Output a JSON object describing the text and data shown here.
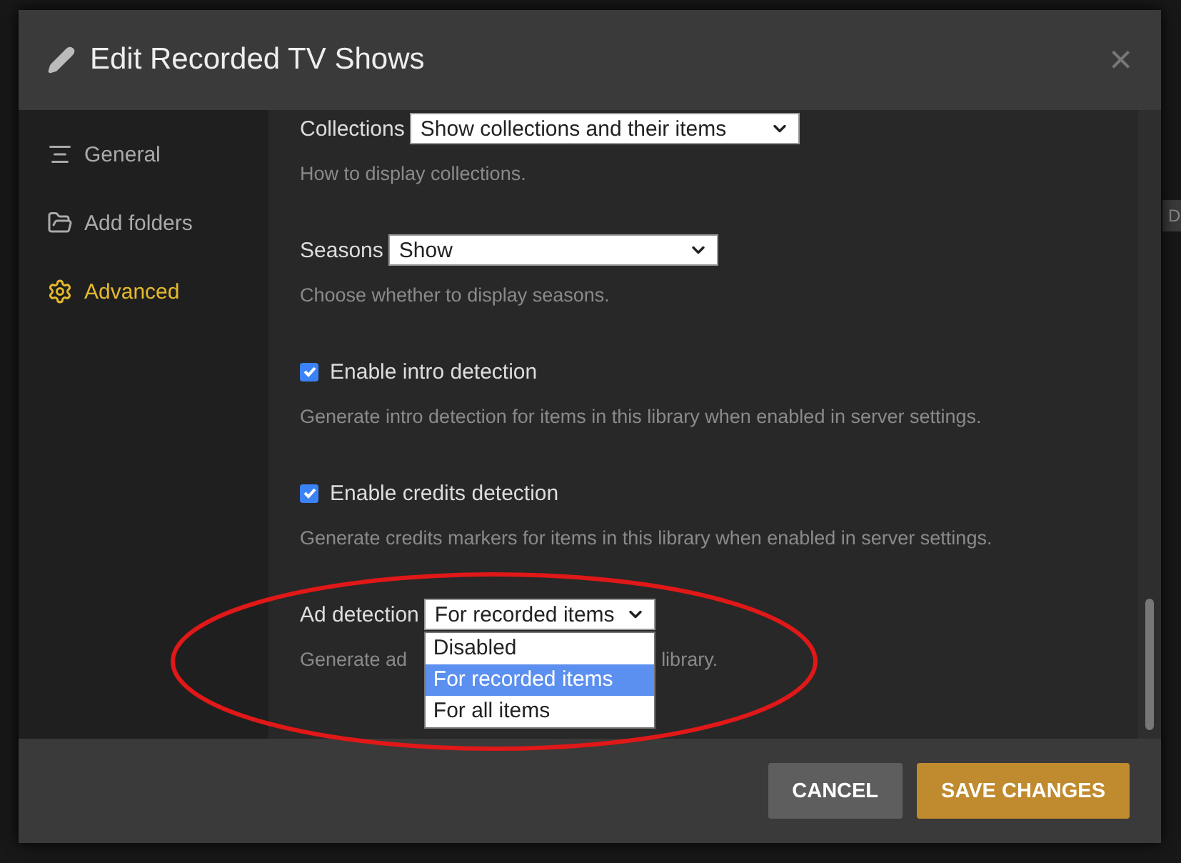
{
  "background_fragment": "D",
  "dialog": {
    "title": "Edit Recorded TV Shows",
    "close": "×"
  },
  "sidebar": {
    "items": [
      {
        "label": "General",
        "selected": false
      },
      {
        "label": "Add folders",
        "selected": false
      },
      {
        "label": "Advanced",
        "selected": true
      }
    ]
  },
  "settings": [
    {
      "kind": "select",
      "label": "Collections",
      "value": "Show collections and their items",
      "hint": "How to display collections."
    },
    {
      "kind": "select",
      "label": "Seasons",
      "value": "Show",
      "hint": "Choose whether to display seasons."
    },
    {
      "kind": "checkbox",
      "label": "Enable intro detection",
      "checked": true,
      "hint": "Generate intro detection for items in this library when enabled in server settings."
    },
    {
      "kind": "checkbox",
      "label": "Enable credits detection",
      "checked": true,
      "hint": "Generate credits markers for items in this library when enabled in server settings."
    },
    {
      "kind": "open-select",
      "label": "Ad detection",
      "value": "For recorded items",
      "hint_parts": [
        "Generate ad",
        "library."
      ],
      "options": [
        {
          "label": "Disabled",
          "selected": false
        },
        {
          "label": "For recorded items",
          "selected": true
        },
        {
          "label": "For all items",
          "selected": false
        }
      ]
    }
  ],
  "buttons": [
    {
      "label": "CANCEL",
      "kind": "secondary"
    },
    {
      "label": "SAVE CHANGES",
      "kind": "primary"
    }
  ]
}
